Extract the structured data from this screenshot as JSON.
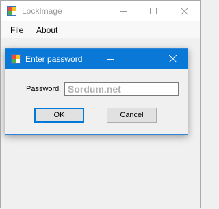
{
  "main_window": {
    "title": "LockImage",
    "icon": "app-icon",
    "minimize_icon": "minimize-icon",
    "maximize_icon": "maximize-icon",
    "close_icon": "close-icon"
  },
  "menu": {
    "items": [
      {
        "label": "File"
      },
      {
        "label": "About"
      }
    ]
  },
  "dialog": {
    "title": "Enter password",
    "icon": "app-icon",
    "password_label": "Password",
    "password_placeholder": "Sordum.net",
    "password_value": "",
    "ok_label": "OK",
    "cancel_label": "Cancel",
    "accent_color": "#0a78d7"
  }
}
